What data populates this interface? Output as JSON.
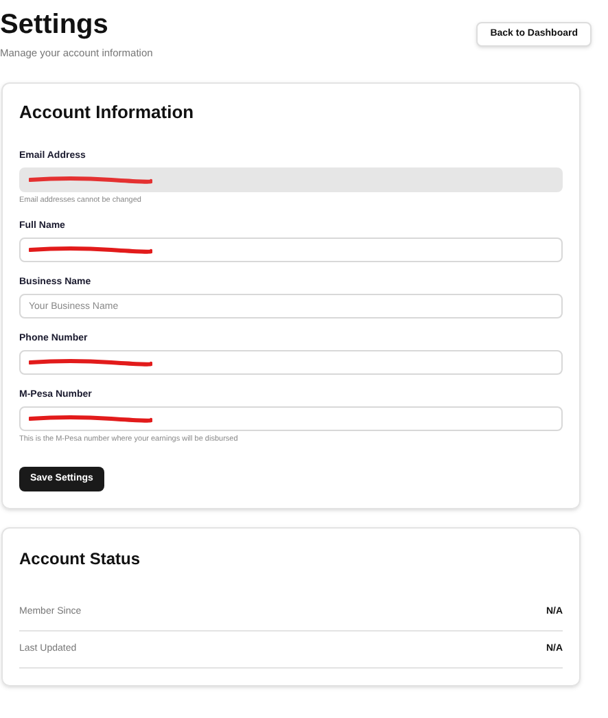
{
  "header": {
    "title": "Settings",
    "subtitle": "Manage your account information",
    "back_button": "Back to Dashboard"
  },
  "account_information": {
    "title": "Account Information",
    "fields": [
      {
        "label": "Email Address",
        "redacted": true,
        "disabled": true,
        "hint": "Email addresses cannot be changed"
      },
      {
        "label": "Full Name",
        "redacted": true,
        "disabled": false
      },
      {
        "label": "Business Name",
        "placeholder": "Your Business Name",
        "redacted": false,
        "disabled": false
      },
      {
        "label": "Phone Number",
        "redacted": true,
        "disabled": false
      },
      {
        "label": "M-Pesa Number",
        "redacted": true,
        "disabled": false,
        "hint": "This is the M-Pesa number where your earnings will be disbursed"
      }
    ],
    "save_button": "Save Settings"
  },
  "account_status": {
    "title": "Account Status",
    "rows": [
      {
        "label": "Member Since",
        "value": "N/A"
      },
      {
        "label": "Last Updated",
        "value": "N/A"
      }
    ]
  }
}
